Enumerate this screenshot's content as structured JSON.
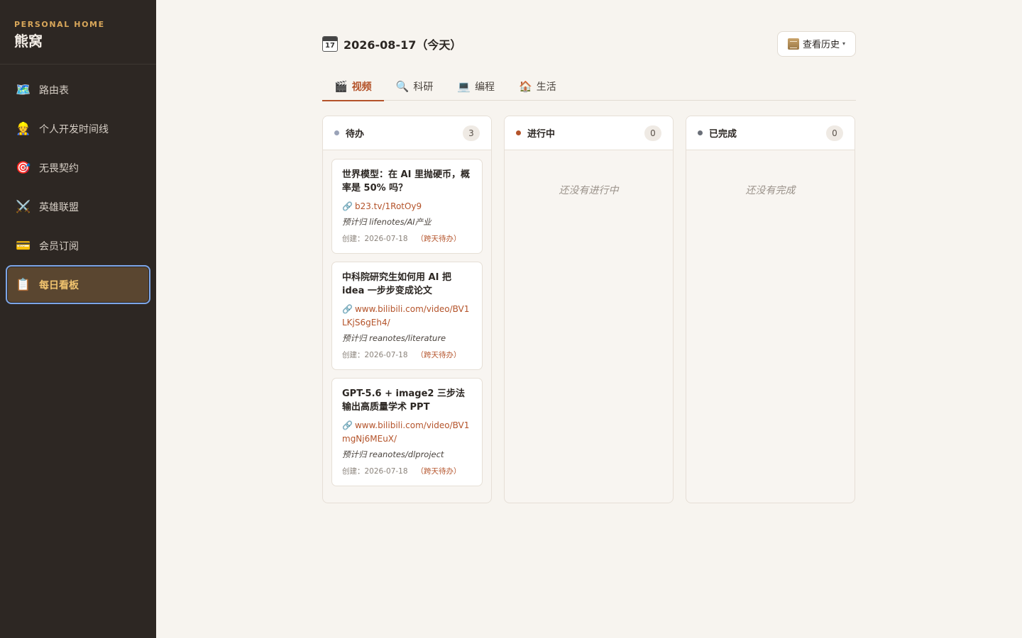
{
  "sidebar": {
    "brand_sub": "PERSONAL HOME",
    "brand_title": "熊窝",
    "items": [
      {
        "label": "路由表",
        "icon": "map-icon",
        "glyph": "🗺️"
      },
      {
        "label": "个人开发时间线",
        "icon": "developer-icon",
        "glyph": "👷"
      },
      {
        "label": "无畏契约",
        "icon": "target-icon",
        "glyph": "🎯"
      },
      {
        "label": "英雄联盟",
        "icon": "crossed-swords-icon",
        "glyph": "⚔️"
      },
      {
        "label": "会员订阅",
        "icon": "credit-card-icon",
        "glyph": "💳"
      },
      {
        "label": "每日看板",
        "icon": "clipboard-icon",
        "glyph": "📋"
      }
    ]
  },
  "header": {
    "date": "2026-08-17（今天）",
    "calendar_day": "17",
    "history_label": "查看历史",
    "history_caret": "▾"
  },
  "tabs": [
    {
      "label": "视频",
      "glyph": "🎬"
    },
    {
      "label": "科研",
      "glyph": "🔍"
    },
    {
      "label": "编程",
      "glyph": "💻"
    },
    {
      "label": "生活",
      "glyph": "🏠"
    }
  ],
  "columns": {
    "todo": {
      "title": "待办",
      "count": "3",
      "color": "#9aa3b8"
    },
    "doing": {
      "title": "进行中",
      "count": "0",
      "color": "#b4532a",
      "empty": "还没有进行中"
    },
    "done": {
      "title": "已完成",
      "count": "0",
      "color": "#6a6f78",
      "empty": "还没有完成"
    }
  },
  "cards": [
    {
      "title": "世界模型：在 AI 里抛硬币，概率是 50% 吗？",
      "link": "b23.tv/1RotOy9",
      "dest": "预计归 lifenotes/AI产业",
      "created": "创建：2026-07-18",
      "carry": "（跨天待办）"
    },
    {
      "title": "中科院研究生如何用 AI 把 idea 一步步变成论文",
      "link": "www.bilibili.com/video/BV1LKjS6gEh4/",
      "dest": "预计归 reanotes/literature",
      "created": "创建：2026-07-18",
      "carry": "（跨天待办）"
    },
    {
      "title": "GPT-5.6 + image2 三步法输出高质量学术 PPT",
      "link": "www.bilibili.com/video/BV1mgNj6MEuX/",
      "dest": "预计归 reanotes/dlproject",
      "created": "创建：2026-07-18",
      "carry": "（跨天待办）"
    }
  ]
}
